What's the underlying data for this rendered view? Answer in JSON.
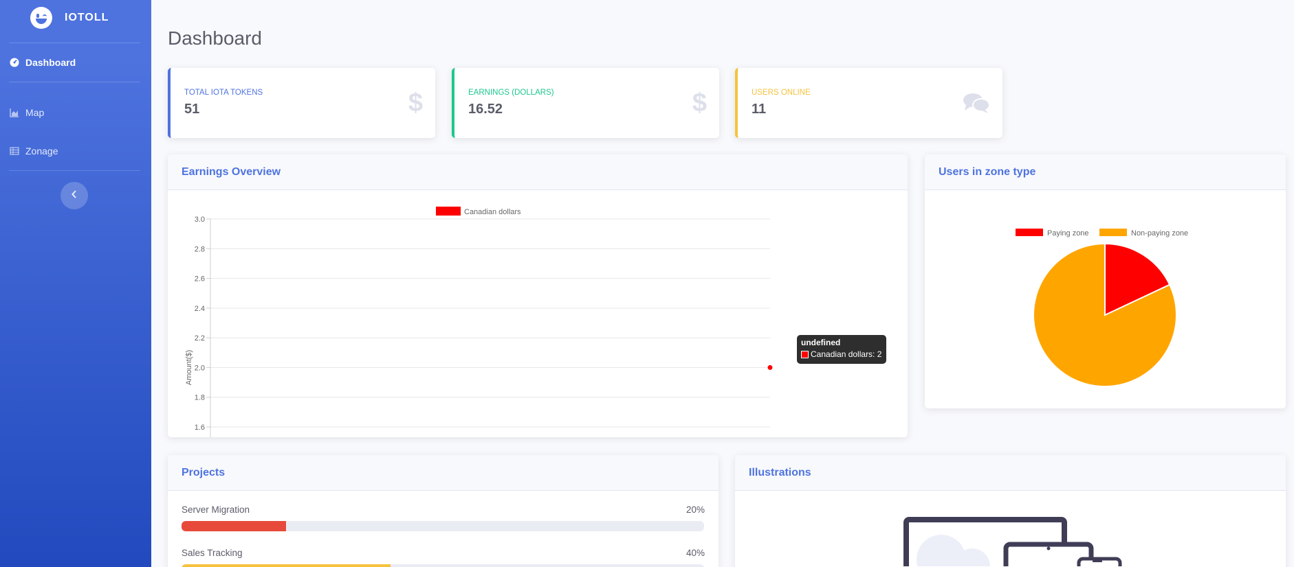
{
  "brand": {
    "name": "IOTOLL"
  },
  "sidebar": {
    "items": [
      {
        "label": "Dashboard",
        "icon": "gauge-icon"
      },
      {
        "label": "Map",
        "icon": "chart-area-icon"
      },
      {
        "label": "Zonage",
        "icon": "table-icon"
      }
    ],
    "toggle_icon": "chevron-left-icon"
  },
  "page": {
    "title": "Dashboard"
  },
  "stats": [
    {
      "label": "TOTAL IOTA TOKENS",
      "value": "51",
      "color": "#4e73df",
      "icon": "dollar-icon"
    },
    {
      "label": "EARNINGS (DOLLARS)",
      "value": "16.52",
      "color": "#1cc88a",
      "icon": "dollar-icon"
    },
    {
      "label": "USERS ONLINE",
      "value": "11",
      "color": "#f6c23e",
      "icon": "comments-icon"
    }
  ],
  "earnings": {
    "title": "Earnings Overview",
    "tooltip": {
      "title": "undefined",
      "label": "Canadian dollars: 2"
    }
  },
  "zones": {
    "title": "Users in zone type"
  },
  "projects": {
    "title": "Projects",
    "items": [
      {
        "name": "Server Migration",
        "percent": "20%",
        "value": 20,
        "color": "#e74a3b"
      },
      {
        "name": "Sales Tracking",
        "percent": "40%",
        "value": 40,
        "color": "#f6c23e"
      }
    ]
  },
  "illustrations": {
    "title": "Illustrations"
  },
  "chart_data": [
    {
      "type": "line",
      "series": [
        {
          "name": "Canadian dollars",
          "color": "#ff0000",
          "values": [
            2
          ]
        }
      ],
      "ylabel": "Amount($)",
      "ylim": [
        1.6,
        3.0
      ],
      "y_ticks": [
        "3.0",
        "2.8",
        "2.6",
        "2.4",
        "2.2",
        "2.0",
        "1.8",
        "1.6"
      ],
      "grid": true,
      "legend": "top"
    },
    {
      "type": "pie",
      "categories": [
        "Paying zone",
        "Non-paying zone"
      ],
      "values": [
        18,
        82
      ],
      "colors": [
        "#ff0000",
        "#ffa500"
      ],
      "legend": "top"
    }
  ]
}
